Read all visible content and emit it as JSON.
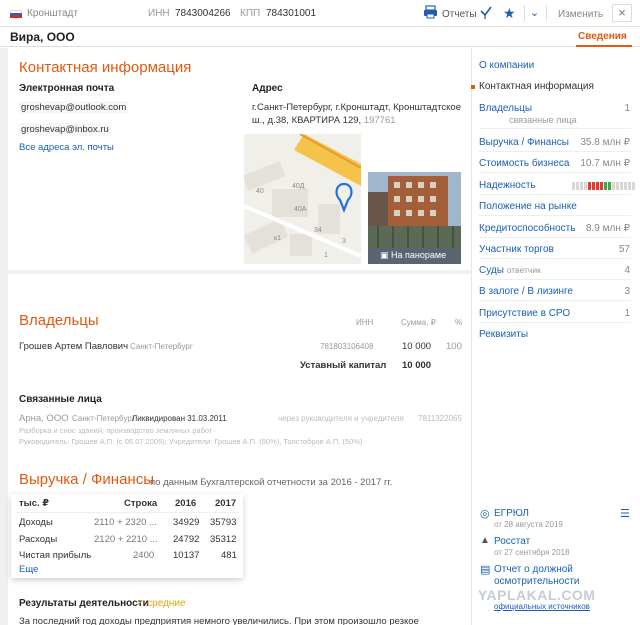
{
  "topbar": {
    "city": "Кронштадт",
    "inn_label": "ИНН",
    "inn": "7843004266",
    "kpp_label": "КПП",
    "kpp": "784301001",
    "reports_label": "Отчеты",
    "edit_label": "Изменить",
    "close_glyph": "×",
    "flag_colors": [
      "#ffffff",
      "#2a5bd7",
      "#d52b1e"
    ]
  },
  "subbar": {
    "company": "Вира, ООО",
    "active_tab": "Сведения"
  },
  "contacts": {
    "title": "Контактная информация",
    "email_label": "Электронная почта",
    "emails": [
      "groshevap@outlook.com",
      "groshevap@inbox.ru"
    ],
    "all_emails_link": "Все адреса эл. почты",
    "address_label": "Адрес",
    "address_line1": "г.Санкт-Петербург, г.Кронштадт, Кронштадтское",
    "address_line2": "ш., д.38, КВАРТИРА 129,",
    "postcode": "197761",
    "map_labels": [
      "40Д",
      "40",
      "40А",
      "34",
      "3",
      "к1",
      "1"
    ],
    "pano_label": "На панораме"
  },
  "owners": {
    "title": "Владельцы",
    "col_inn": "ИНН",
    "col_sum": "Сумма, ₽",
    "col_pct": "%",
    "name": "Грошев Артем Павлович",
    "location": "Санкт-Петербург",
    "inn": "781803106408",
    "sum": "10 000",
    "pct": "100",
    "capital_label": "Уставный капитал",
    "capital": "10 000"
  },
  "related": {
    "title": "Связанные лица",
    "name": "Арна, ООО",
    "city": "Санкт-Петербург",
    "status": "Ликвидирован 31.03.2011",
    "via": "через руководителя и учредителя",
    "inn": "7811322065",
    "activity": "Разборка и снос зданий; производство земляных работ",
    "management": "Руководитель: Грошев А.П. (с 06.07.2005); Учредители: Грошев А.П. (50%), Толстобров А.П. (50%)"
  },
  "finance": {
    "title": "Выручка / Финансы",
    "subtitle": "по данным Бухгалтерской отчетности за 2016 - 2017 гг.",
    "headers": [
      "тыс. ₽",
      "Строка",
      "2016",
      "2017"
    ],
    "rows": [
      [
        "Доходы",
        "2110 + 2320 ...",
        "34929",
        "35793"
      ],
      [
        "Расходы",
        "2120 + 2210 ...",
        "24792",
        "35312"
      ],
      [
        "Чистая прибыль",
        "2400",
        "10137",
        "481"
      ]
    ],
    "more_link": "Еще",
    "results_label": "Результаты деятельности",
    "results_value": "средние",
    "summary_text": "За последний год доходы предприятия немного увеличились. При этом произошло резкое сокращение"
  },
  "sidebar": {
    "items": [
      {
        "label": "О компании",
        "value": ""
      },
      {
        "label": "Контактная информация",
        "value": ""
      },
      {
        "label": "Владельцы",
        "value": "1",
        "sub": "связанные лица"
      },
      {
        "label": "Выручка / Финансы",
        "value": "35.8 млн ₽"
      },
      {
        "label": "Стоимость бизнеса",
        "value": "10.7 млн ₽"
      },
      {
        "label": "Надежность",
        "value": ""
      },
      {
        "label": "Положение на рынке",
        "value": ""
      },
      {
        "label": "Кредитоспособность",
        "value": "8.9 млн ₽"
      },
      {
        "label": "Участник торгов",
        "value": "57"
      },
      {
        "label": "Суды",
        "value": "4",
        "tag": "ответчик"
      },
      {
        "label": "В залоге / В лизинге",
        "value": "3"
      },
      {
        "label": "Присутствие в СРО",
        "value": "1"
      },
      {
        "label": "Реквизиты",
        "value": ""
      }
    ],
    "egrul_label": "ЕГРЮЛ",
    "egrul_date": "от 28 августа 2019",
    "rosstat_label": "Росстат",
    "rosstat_date": "от 27 сентября 2018",
    "report_label1": "Отчет о должной",
    "report_label2": "осмотрительности",
    "report_sub": "официальных источников",
    "reliability_colors": [
      "#d8d8d8",
      "#d8d8d8",
      "#d8d8d8",
      "#d8d8d8",
      "#e23b2e",
      "#e23b2e",
      "#e23b2e",
      "#e23b2e",
      "#3aa845",
      "#3aa845",
      "#d8d8d8",
      "#d8d8d8",
      "#d8d8d8",
      "#d8d8d8",
      "#d8d8d8",
      "#d8d8d8"
    ]
  },
  "watermark": "YAPLAKAL.COM"
}
